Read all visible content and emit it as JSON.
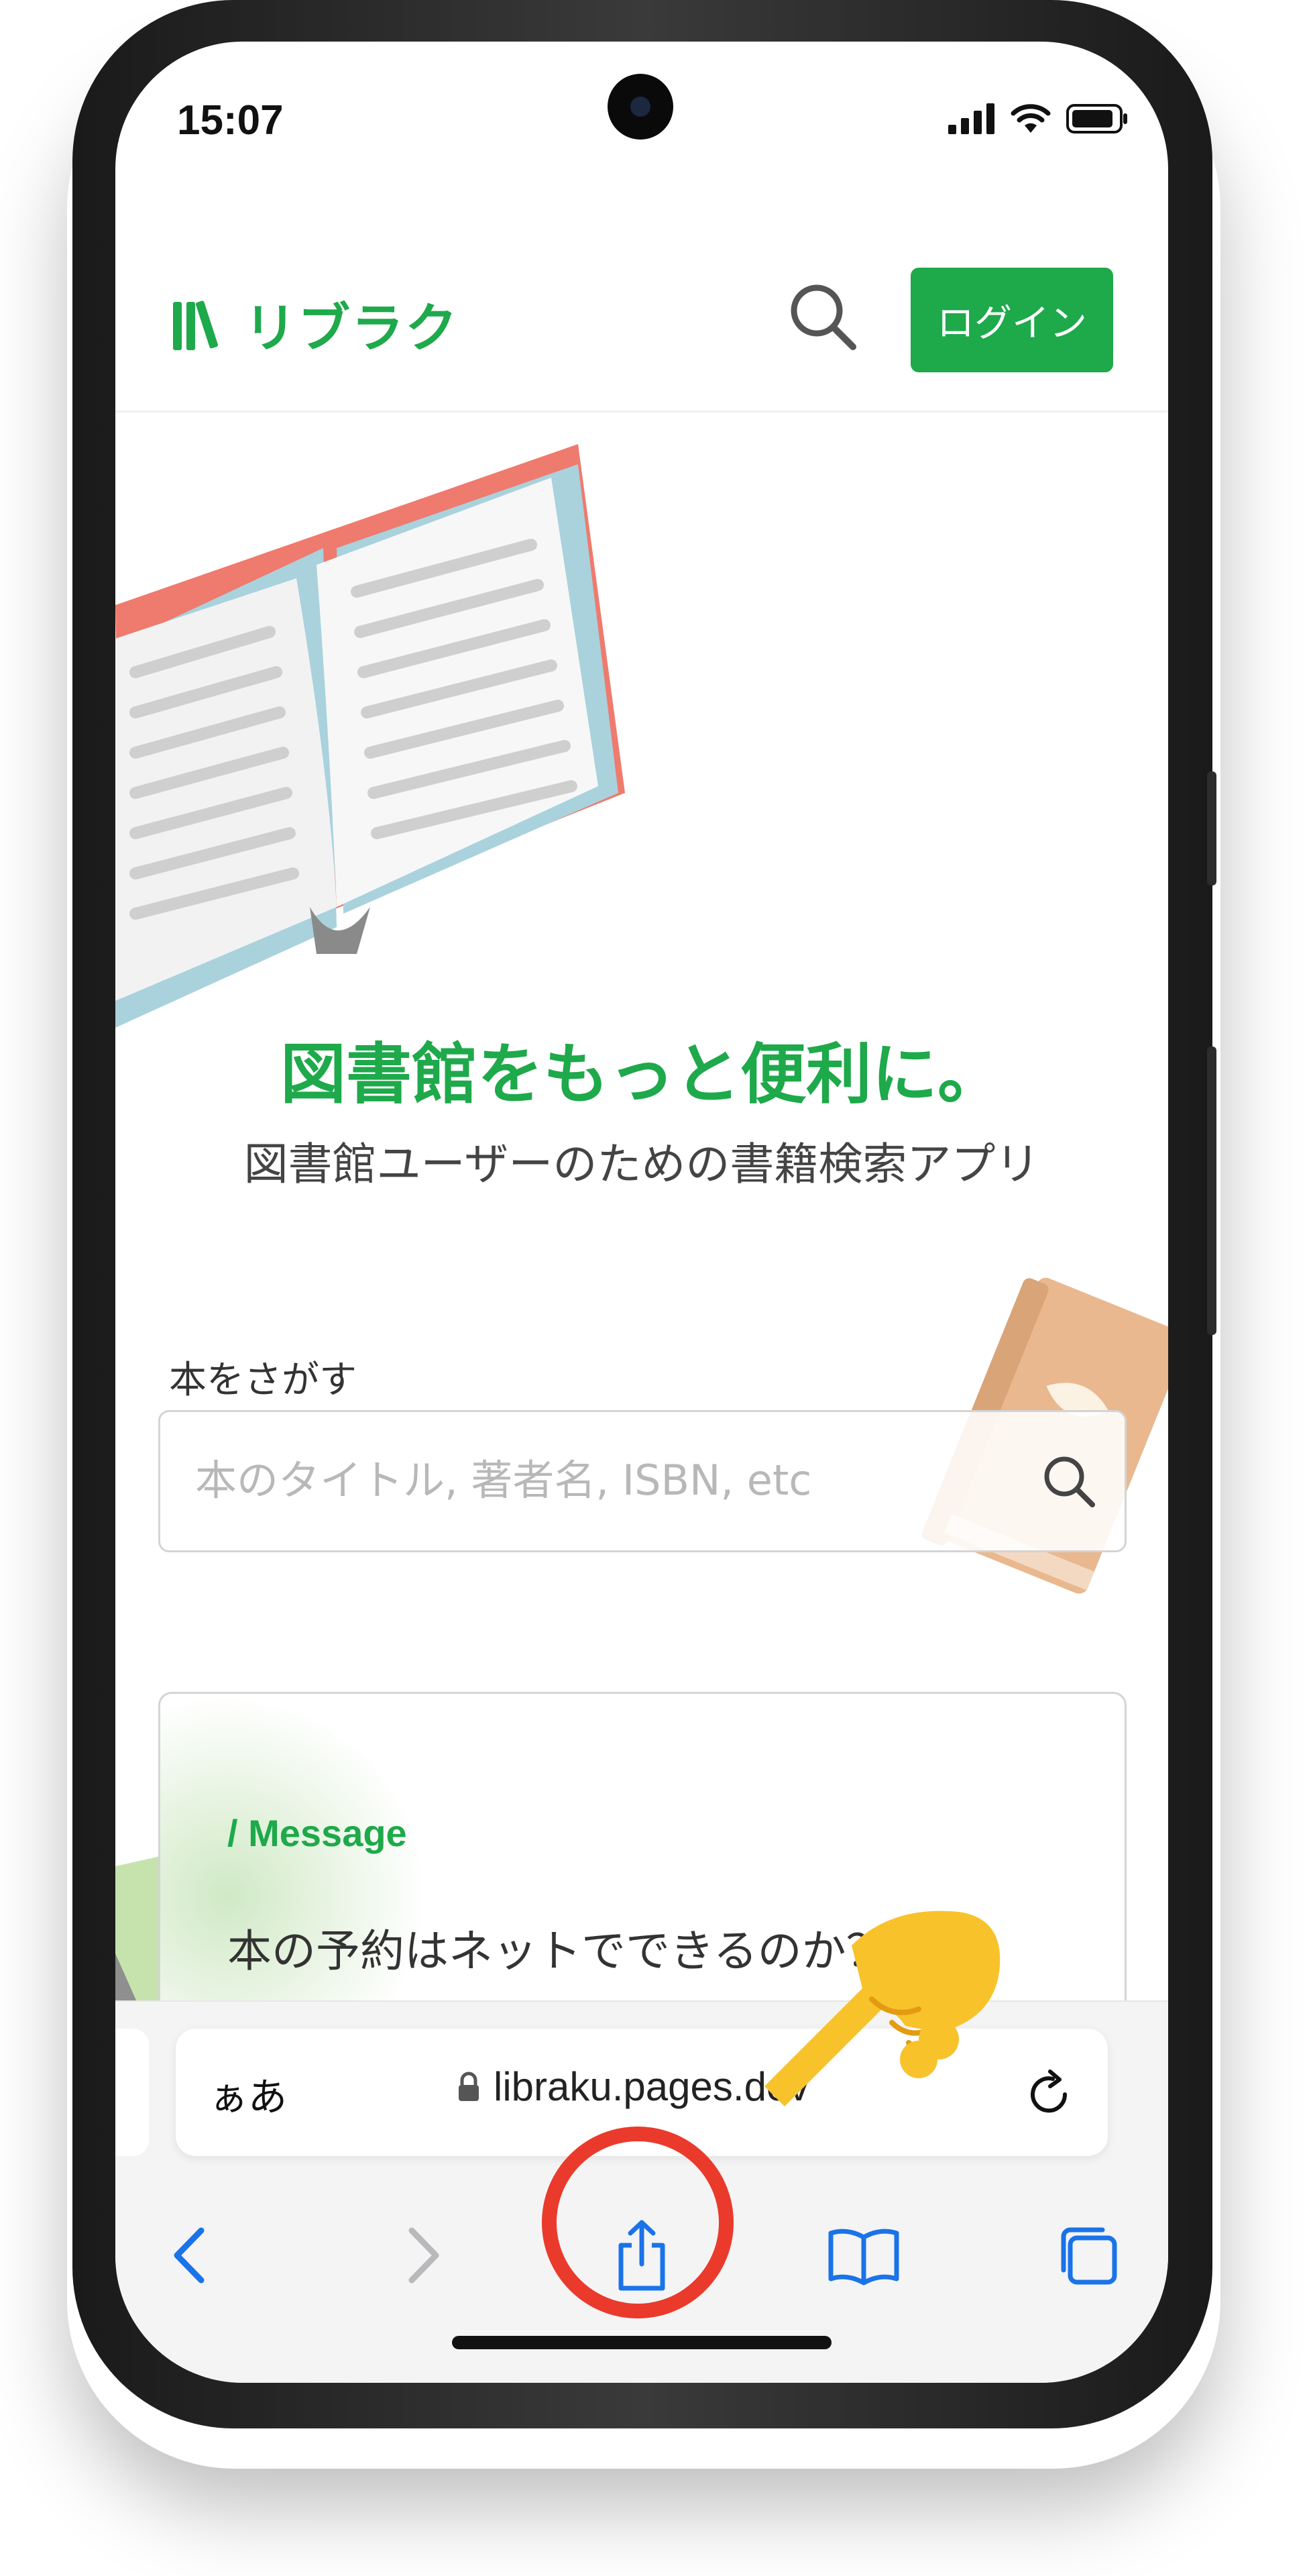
{
  "status_bar": {
    "time": "15:07"
  },
  "header": {
    "logo_text": "リブラク",
    "login_label": "ログイン"
  },
  "hero": {
    "title": "図書館をもっと便利に。",
    "subtitle": "図書館ユーザーのための書籍検索アプリ"
  },
  "search": {
    "label": "本をさがす",
    "placeholder": "本のタイトル, 著者名, ISBN, etc"
  },
  "message": {
    "label": "/ Message",
    "text": "本の予約はネットでできるのか？"
  },
  "browser": {
    "text_size_label": "ぁあ",
    "url": "libraku.pages.dev"
  },
  "colors": {
    "brand_green": "#1ea94b",
    "highlight_red": "#ea3a2c",
    "safari_blue": "#1a73e8"
  },
  "icons": [
    "search-icon",
    "share-icon",
    "back-icon",
    "forward-icon",
    "bookmarks-icon",
    "tabs-icon",
    "reload-icon",
    "lock-icon",
    "pointing-hand-icon"
  ]
}
